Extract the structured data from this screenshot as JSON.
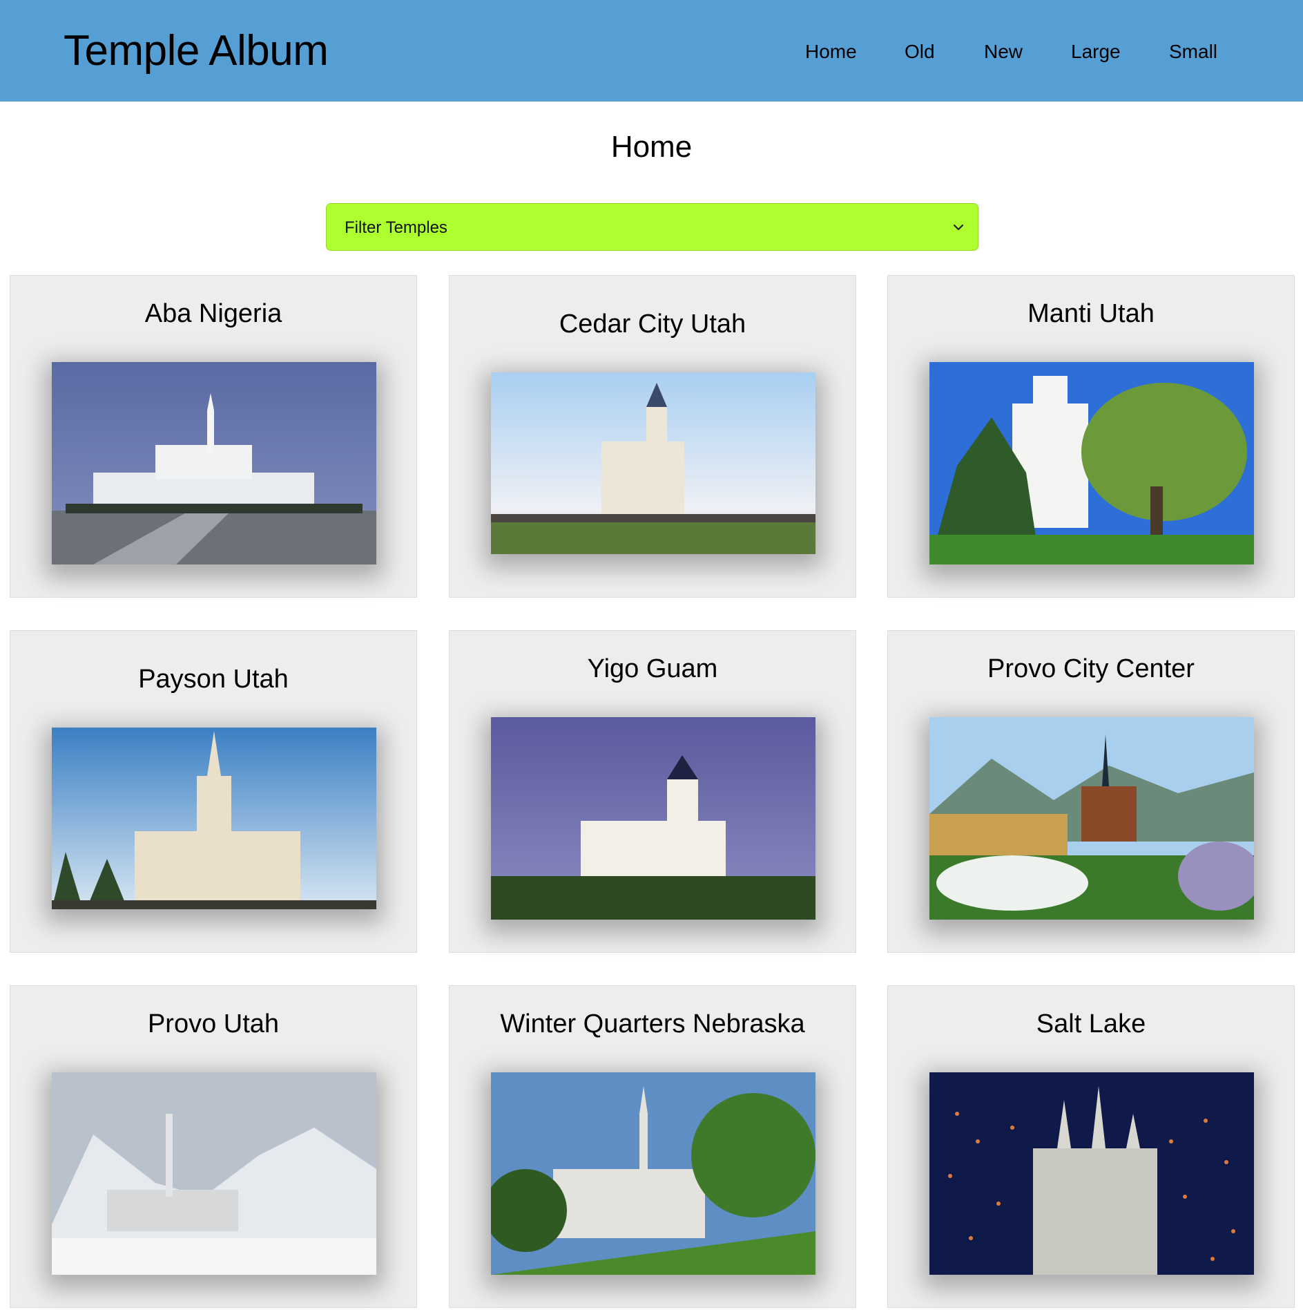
{
  "header": {
    "brand": "Temple Album",
    "nav": [
      {
        "label": "Home"
      },
      {
        "label": "Old"
      },
      {
        "label": "New"
      },
      {
        "label": "Large"
      },
      {
        "label": "Small"
      }
    ]
  },
  "main": {
    "title": "Home",
    "filter": {
      "selected": "Filter Temples",
      "icon": "chevron-down-icon"
    },
    "temples": [
      {
        "name": "Aba Nigeria"
      },
      {
        "name": "Cedar City Utah"
      },
      {
        "name": "Manti Utah"
      },
      {
        "name": "Payson Utah"
      },
      {
        "name": "Yigo Guam"
      },
      {
        "name": "Provo City Center"
      },
      {
        "name": "Provo Utah"
      },
      {
        "name": "Winter Quarters Nebraska"
      },
      {
        "name": "Salt Lake"
      }
    ]
  },
  "colors": {
    "header_bg": "#569fd5",
    "filter_bg": "#adff2f",
    "card_bg": "#ededed"
  }
}
